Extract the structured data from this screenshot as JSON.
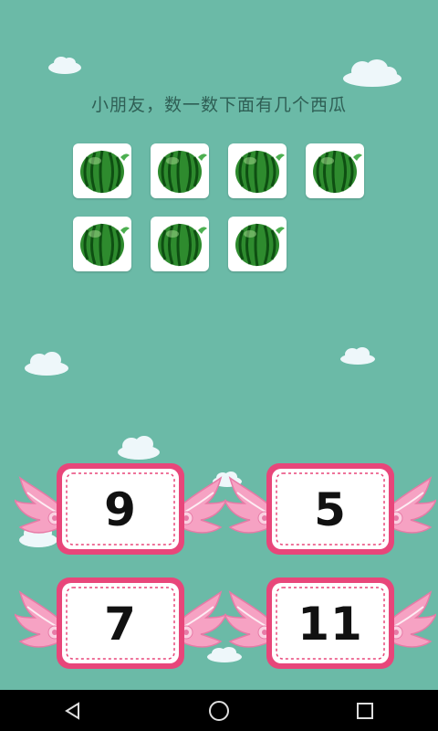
{
  "game": {
    "question": "小朋友，数一数下面有几个西瓜",
    "item_icon": "watermelon-icon",
    "item_count": 7,
    "answers": [
      {
        "label": "9"
      },
      {
        "label": "5"
      },
      {
        "label": "7"
      },
      {
        "label": "11"
      }
    ]
  },
  "colors": {
    "background": "#6bbaa7",
    "card_border": "#e8467a",
    "wing": "#f6a2c3",
    "watermelon": "#2f8f2f"
  },
  "navbar": {
    "back_icon": "back-triangle-icon",
    "home_icon": "home-circle-icon",
    "recents_icon": "recents-square-icon"
  }
}
